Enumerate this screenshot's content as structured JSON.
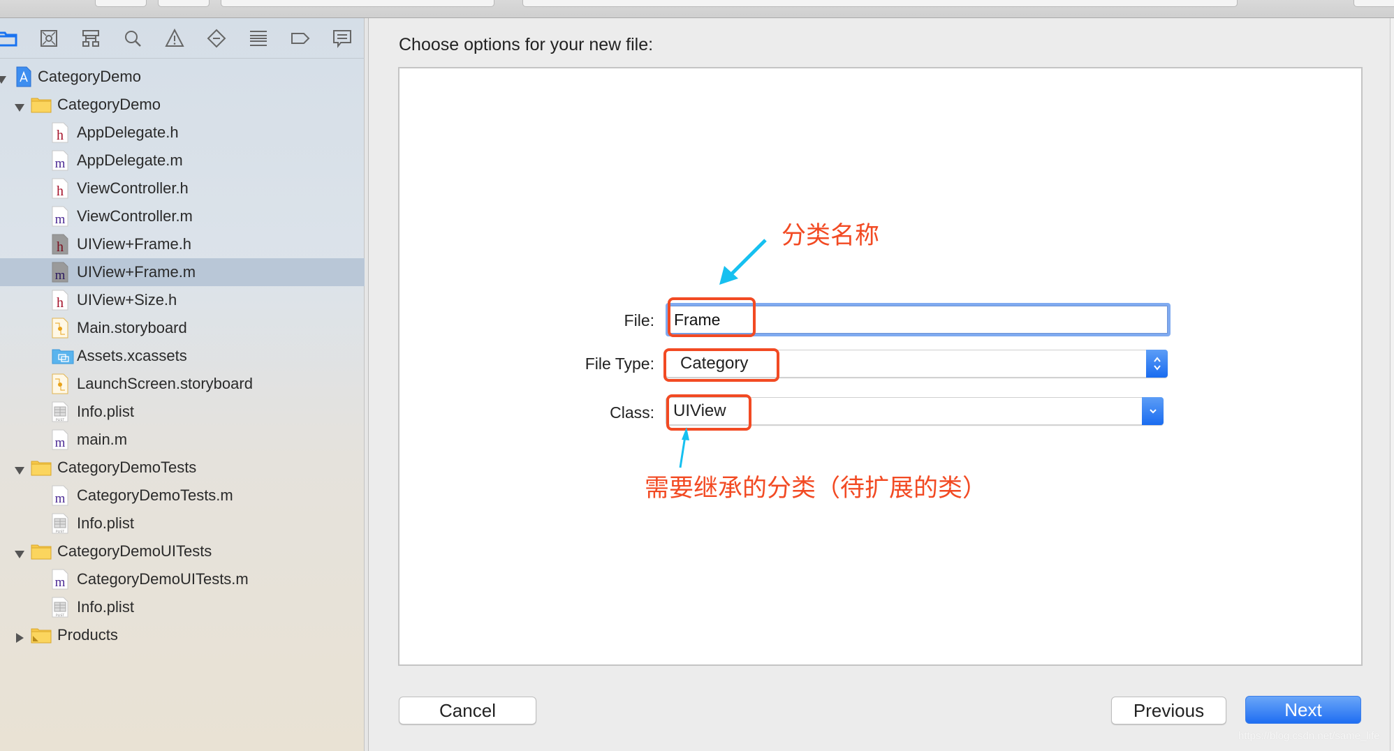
{
  "navigator": {
    "icons": [
      {
        "name": "project-navigator-icon",
        "active": true
      },
      {
        "name": "source-control-icon"
      },
      {
        "name": "symbol-navigator-icon"
      },
      {
        "name": "find-icon"
      },
      {
        "name": "issue-warning-icon"
      },
      {
        "name": "test-navigator-icon"
      },
      {
        "name": "debug-navigator-icon"
      },
      {
        "name": "breakpoint-icon"
      },
      {
        "name": "report-icon"
      }
    ],
    "tree": [
      {
        "label": "CategoryDemo",
        "level": 0,
        "kind": "project",
        "disclosure": "open"
      },
      {
        "label": "CategoryDemo",
        "level": 1,
        "kind": "folder",
        "disclosure": "open"
      },
      {
        "label": "AppDelegate.h",
        "level": 2,
        "kind": "h"
      },
      {
        "label": "AppDelegate.m",
        "level": 2,
        "kind": "m"
      },
      {
        "label": "ViewController.h",
        "level": 2,
        "kind": "h"
      },
      {
        "label": "ViewController.m",
        "level": 2,
        "kind": "m"
      },
      {
        "label": "UIView+Frame.h",
        "level": 2,
        "kind": "h-gray"
      },
      {
        "label": "UIView+Frame.m",
        "level": 2,
        "kind": "m-gray",
        "selected": true
      },
      {
        "label": "UIView+Size.h",
        "level": 2,
        "kind": "h"
      },
      {
        "label": "Main.storyboard",
        "level": 2,
        "kind": "storyboard"
      },
      {
        "label": "Assets.xcassets",
        "level": 2,
        "kind": "assets"
      },
      {
        "label": "LaunchScreen.storyboard",
        "level": 2,
        "kind": "storyboard"
      },
      {
        "label": "Info.plist",
        "level": 2,
        "kind": "plist"
      },
      {
        "label": "main.m",
        "level": 2,
        "kind": "m"
      },
      {
        "label": "CategoryDemoTests",
        "level": 1,
        "kind": "folder",
        "disclosure": "open"
      },
      {
        "label": "CategoryDemoTests.m",
        "level": 2,
        "kind": "m"
      },
      {
        "label": "Info.plist",
        "level": 2,
        "kind": "plist"
      },
      {
        "label": "CategoryDemoUITests",
        "level": 1,
        "kind": "folder",
        "disclosure": "open"
      },
      {
        "label": "CategoryDemoUITests.m",
        "level": 2,
        "kind": "m"
      },
      {
        "label": "Info.plist",
        "level": 2,
        "kind": "plist"
      },
      {
        "label": "Products",
        "level": 1,
        "kind": "products-folder",
        "disclosure": "closed"
      }
    ]
  },
  "dialog": {
    "title": "Choose options for your new file:",
    "fields": {
      "file_label": "File:",
      "file_value": "Frame",
      "file_type_label": "File Type:",
      "file_type_value": "Category",
      "class_label": "Class:",
      "class_value": "UIView"
    },
    "buttons": {
      "cancel": "Cancel",
      "previous": "Previous",
      "next": "Next"
    }
  },
  "annotations": {
    "category_name": "分类名称",
    "class_to_extend": "需要继承的分类（待扩展的类）",
    "color": "#f24a23",
    "arrow_color": "#16c0f0"
  },
  "colors": {
    "accent": "#1f6ef2",
    "selection": "#b9c7d7",
    "focus_ring": "#7faaf0"
  },
  "watermark": "https://blog.csdn.net/same_life"
}
